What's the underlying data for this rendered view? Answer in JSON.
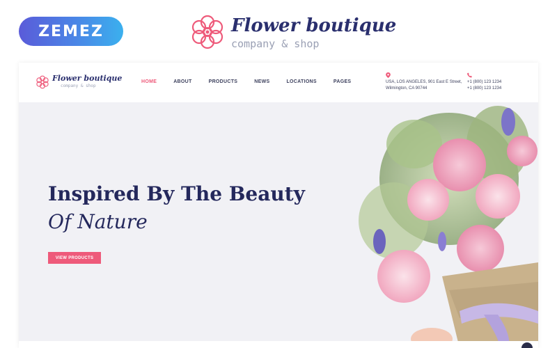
{
  "promo": {
    "badge_text": "ZEMEZ",
    "logo_title": "Flower boutique",
    "logo_subtitle": "company & shop"
  },
  "site": {
    "logo_title": "Flower boutique",
    "logo_subtitle": "company & shop",
    "menu": [
      {
        "label": "HOME",
        "active": true
      },
      {
        "label": "ABOUT",
        "active": false
      },
      {
        "label": "PRODUCTS",
        "active": false
      },
      {
        "label": "NEWS",
        "active": false
      },
      {
        "label": "LOCATIONS",
        "active": false
      },
      {
        "label": "PAGES",
        "active": false
      }
    ],
    "contact": {
      "address_line1": "USA, LOS ANGELES, 901 East E Street,",
      "address_line2": "Wilmington, CA 90744",
      "phone1": "+1 (800) 123 1234",
      "phone2": "+1 (800) 123 1234"
    }
  },
  "hero": {
    "title": "Inspired By The Beauty",
    "subtitle": "Of Nature",
    "button_label": "VIEW PRODUCTS"
  },
  "colors": {
    "accent": "#ee5a7a",
    "navy": "#24285c",
    "badge_gradient_start": "#5a5bd9",
    "badge_gradient_end": "#3bb0ee"
  },
  "icons": {
    "location": "map-pin-icon",
    "phone": "phone-icon",
    "logo": "flower-icon"
  }
}
